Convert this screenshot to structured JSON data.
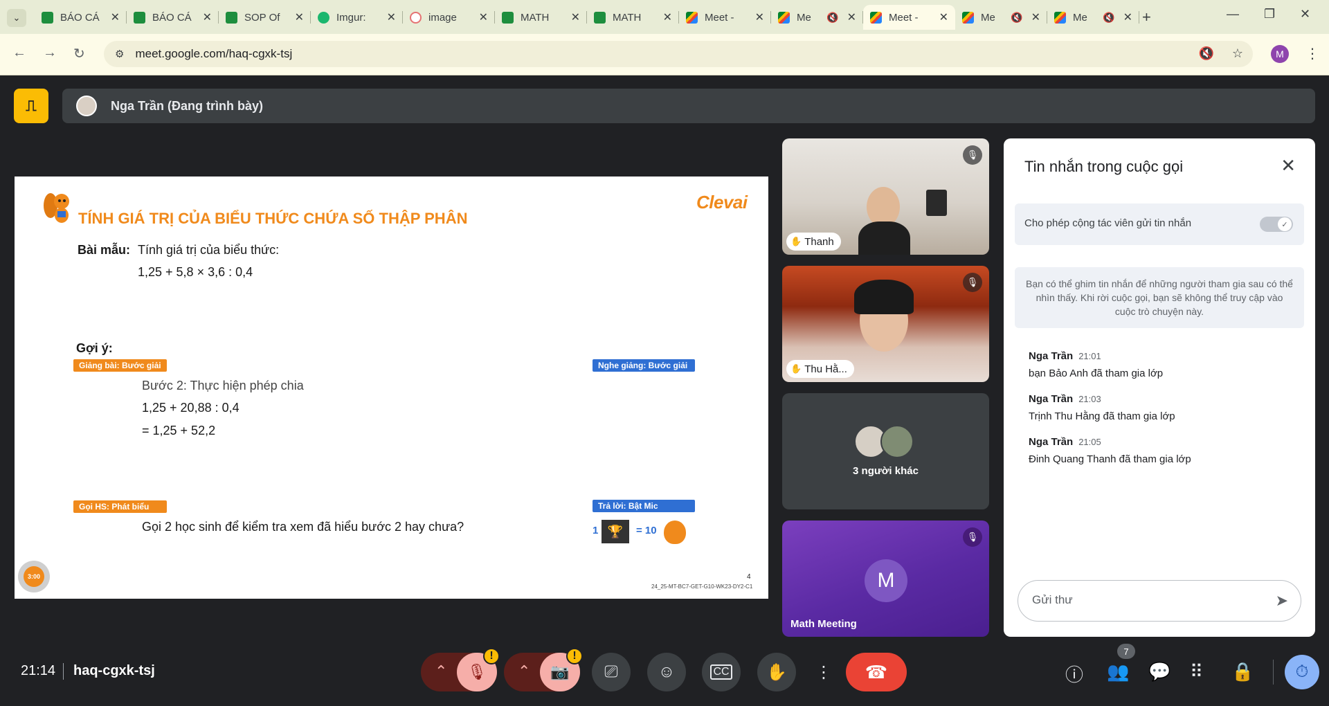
{
  "browser": {
    "tabs": [
      {
        "title": "BÁO CÁ",
        "favicon": "sheets-icon",
        "active": false,
        "muted": false
      },
      {
        "title": "BÁO CÁ",
        "favicon": "sheets-icon",
        "active": false,
        "muted": false
      },
      {
        "title": "SOP Of",
        "favicon": "sheets-icon",
        "active": false,
        "muted": false
      },
      {
        "title": "Imgur:",
        "favicon": "imgur-icon",
        "active": false,
        "muted": false
      },
      {
        "title": "image",
        "favicon": "image-icon",
        "active": false,
        "muted": false
      },
      {
        "title": "MATH",
        "favicon": "sheets-icon",
        "active": false,
        "muted": false
      },
      {
        "title": "MATH",
        "favicon": "sheets-icon",
        "active": false,
        "muted": false
      },
      {
        "title": "Meet -",
        "favicon": "meet-icon",
        "active": false,
        "muted": false
      },
      {
        "title": "Me",
        "favicon": "meet-icon",
        "active": false,
        "muted": true
      },
      {
        "title": "Meet -",
        "favicon": "meet-icon",
        "active": true,
        "muted": false
      },
      {
        "title": "Me",
        "favicon": "meet-icon",
        "active": false,
        "muted": true
      },
      {
        "title": "Me",
        "favicon": "meet-icon",
        "active": false,
        "muted": true
      }
    ],
    "url": "meet.google.com/haq-cgxk-tsj",
    "profile_initial": "M"
  },
  "presenter": {
    "name": "Nga Trần (Đang trình bày)"
  },
  "slide": {
    "title": "TÍNH GIÁ TRỊ CỦA BIỂU THỨC CHỨA SỐ THẬP PHÂN",
    "brand": "Clevai",
    "example_label": "Bài mẫu:",
    "example_text": "Tính giá trị của biểu thức:",
    "expression": "1,25 + 5,8 × 3,6 : 0,4",
    "hint_label": "Gợi ý:",
    "tag_teach": "Giảng bài: Bước giải",
    "tag_listen": "Nghe giảng: Bước giải",
    "step_title": "Bước 2: Thực hiện phép chia",
    "step_line1": "1,25 + 20,88 : 0,4",
    "step_line2": "= 1,25 + 52,2",
    "tag_call": "Gọi HS: Phát biểu",
    "tag_answer": "Trả lời: Bật Mic",
    "call_text": "Gọi 2 học sinh để kiểm tra xem đã hiểu bước 2 hay chưa?",
    "reward_count": "1",
    "reward_value": "= 10",
    "timer": "3:00",
    "page_number": "4",
    "slide_code": "24_25-MT-BC7-GET-G10-WK23-DY2-C1"
  },
  "participants": {
    "tile1_name": "Thanh",
    "tile2_name": "Thu Hằ...",
    "others_label": "3 người khác",
    "self_initial": "M",
    "self_label": "Math Meeting"
  },
  "chat": {
    "title": "Tin nhắn trong cuộc gọi",
    "toggle_label": "Cho phép cộng tác viên gửi tin nhắn",
    "toggle_on": true,
    "info": "Bạn có thể ghim tin nhắn để những người tham gia sau có thể nhìn thấy. Khi rời cuộc gọi, bạn sẽ không thể truy cập vào cuộc trò chuyện này.",
    "messages": [
      {
        "sender": "Nga Trần",
        "time": "21:01",
        "text": "bạn Bảo Anh đã tham gia lớp"
      },
      {
        "sender": "Nga Trần",
        "time": "21:03",
        "text": "Trịnh Thu Hằng đã tham gia lớp"
      },
      {
        "sender": "Nga Trần",
        "time": "21:05",
        "text": "Đinh Quang Thanh đã tham gia lớp"
      }
    ],
    "input_placeholder": "Gửi thư"
  },
  "bottom": {
    "clock": "21:14",
    "meeting_code": "haq-cgxk-tsj",
    "people_count": "7"
  },
  "colors": {
    "accent_orange": "#f08a1c",
    "hangup_red": "#ea4335",
    "chat_active_blue": "#8ab4f8",
    "warning_yellow": "#fbbc04"
  }
}
